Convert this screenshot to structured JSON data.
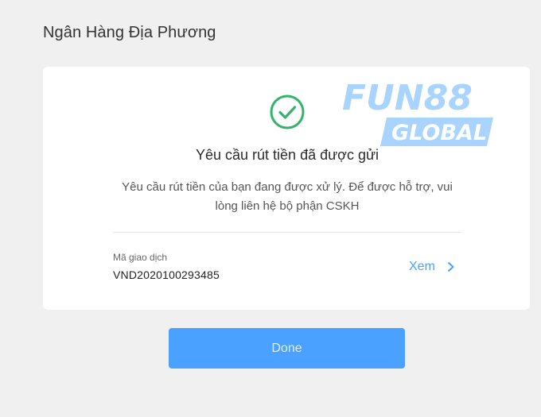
{
  "header": {
    "title": "Ngân Hàng Địa Phương"
  },
  "card": {
    "icon": "check-circle-icon",
    "title": "Yêu cầu rút tiền đã được gửi",
    "description": "Yêu cầu rút tiền của bạn đang được xử lý. Để được hỗ trợ, vui lòng liên hệ bộ phận CSKH",
    "transaction_label": "Mã giao dịch",
    "transaction_id": "VND2020100293485",
    "view_label": "Xem"
  },
  "logo": {
    "brand": "FUN88",
    "sub": "GLOBAL"
  },
  "actions": {
    "done_label": "Done"
  },
  "colors": {
    "accent": "#4aa1ff",
    "success": "#34b36b",
    "background": "#f0f0f0",
    "logo_light": "#a8d4ff"
  }
}
